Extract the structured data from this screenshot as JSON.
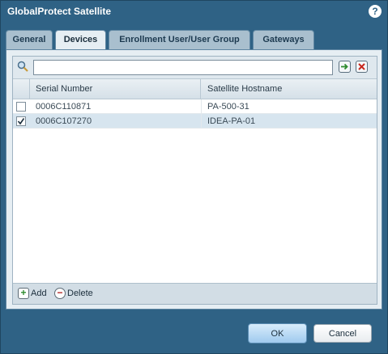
{
  "window": {
    "title": "GlobalProtect Satellite",
    "help_icon": "question-icon",
    "help_glyph": "?"
  },
  "tabs": [
    {
      "label": "General",
      "active": false
    },
    {
      "label": "Devices",
      "active": true
    },
    {
      "label": "Enrollment User/User Group",
      "active": false
    },
    {
      "label": "Gateways",
      "active": false
    }
  ],
  "search": {
    "icon": "search-icon",
    "value": "",
    "placeholder": "",
    "apply_icon": "arrow-right-icon",
    "clear_icon": "clear-x-icon"
  },
  "table": {
    "columns": [
      "Serial Number",
      "Satellite Hostname"
    ],
    "rows": [
      {
        "serial": "0006C110871",
        "hostname": "PA-500-31",
        "checked": false
      },
      {
        "serial": "0006C107270",
        "hostname": "IDEA-PA-01",
        "checked": true
      }
    ]
  },
  "toolbar": {
    "add_label": "Add",
    "delete_label": "Delete"
  },
  "footer": {
    "ok_label": "OK",
    "cancel_label": "Cancel"
  },
  "colors": {
    "dialog_background": "#2f6285",
    "panel_background": "#e6eef3",
    "selected_row": "#d7e5ef"
  }
}
